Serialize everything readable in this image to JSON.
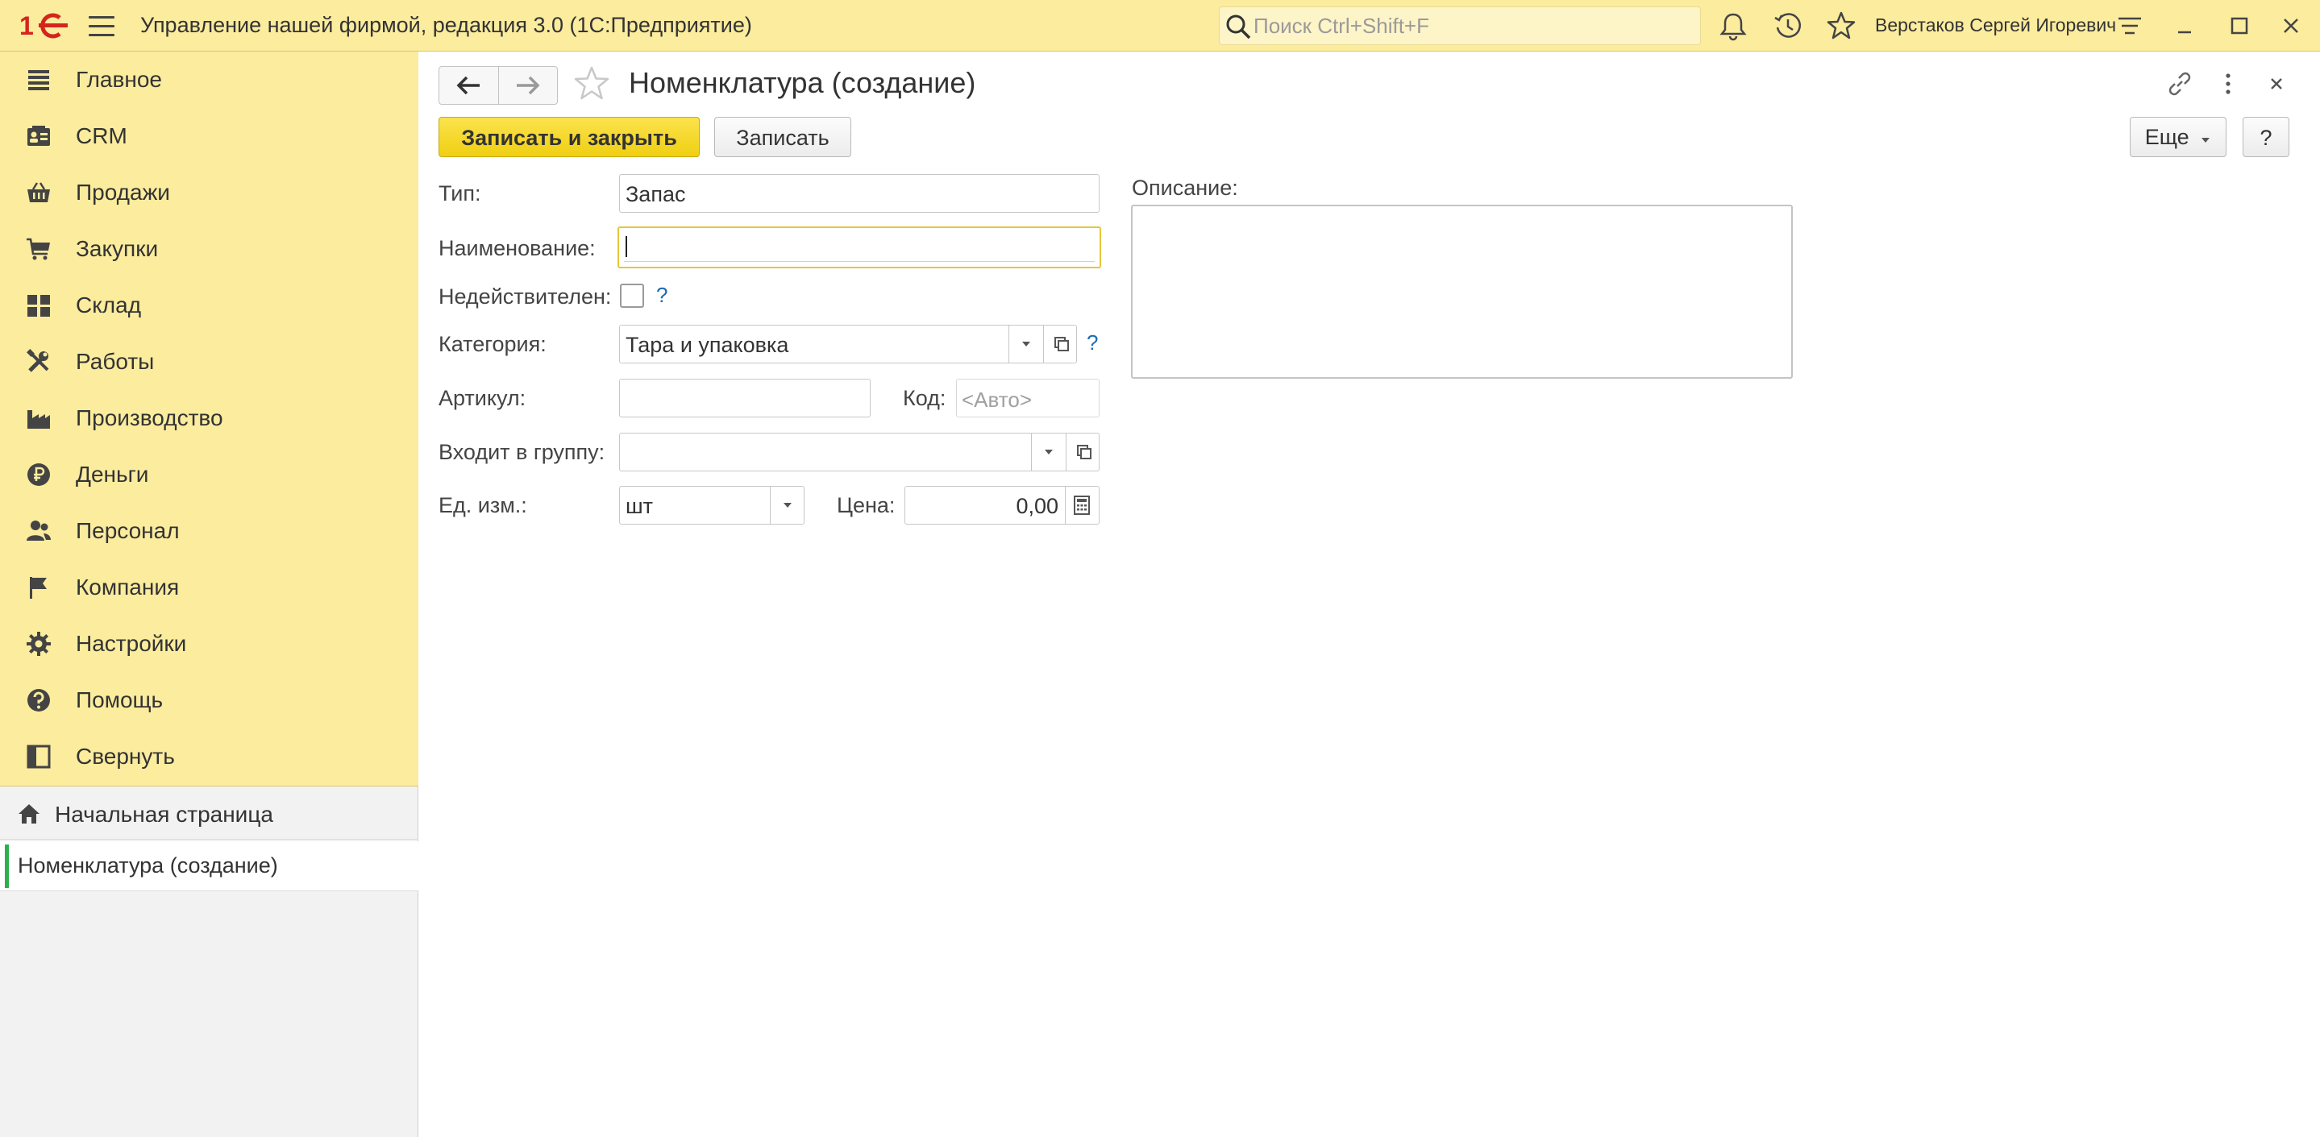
{
  "titlebar": {
    "app_title": "Управление нашей фирмой, редакция 3.0  (1С:Предприятие)",
    "search_placeholder": "Поиск Ctrl+Shift+F",
    "user_name": "Верстаков Сергей Игоревич"
  },
  "sidebar": {
    "sections": [
      {
        "label": "Главное",
        "icon": "menu-lines-icon"
      },
      {
        "label": "CRM",
        "icon": "contact-card-icon"
      },
      {
        "label": "Продажи",
        "icon": "basket-icon"
      },
      {
        "label": "Закупки",
        "icon": "cart-icon"
      },
      {
        "label": "Склад",
        "icon": "warehouse-grid-icon"
      },
      {
        "label": "Работы",
        "icon": "tools-icon"
      },
      {
        "label": "Производство",
        "icon": "factory-icon"
      },
      {
        "label": "Деньги",
        "icon": "ruble-coin-icon"
      },
      {
        "label": "Персонал",
        "icon": "people-icon"
      },
      {
        "label": "Компания",
        "icon": "flag-icon"
      },
      {
        "label": "Настройки",
        "icon": "gear-icon"
      },
      {
        "label": "Помощь",
        "icon": "question-circle-icon"
      },
      {
        "label": "Свернуть",
        "icon": "collapse-panel-icon"
      }
    ],
    "home_label": "Начальная страница",
    "open_window_label": "Номенклатура (создание)"
  },
  "form": {
    "title": "Номенклатура (создание)",
    "save_close_label": "Записать и закрыть",
    "save_label": "Записать",
    "more_label": "Еще",
    "help_label": "?",
    "fields": {
      "type_label": "Тип:",
      "type_value": "Запас",
      "name_label": "Наименование:",
      "name_value": "",
      "invalid_label": "Недействителен:",
      "category_label": "Категория:",
      "category_value": "Тара и упаковка",
      "article_label": "Артикул:",
      "article_value": "",
      "code_label": "Код:",
      "code_placeholder": "<Авто>",
      "group_label": "Входит в группу:",
      "group_value": "",
      "unit_label": "Ед. изм.:",
      "unit_value": "шт",
      "price_label": "Цена:",
      "price_value": "0,00",
      "description_label": "Описание:",
      "help_mark": "?"
    }
  },
  "colors": {
    "panel_yellow": "#fbec9e",
    "primary_button": "#f7d81c",
    "active_marker": "#2db04a",
    "help_blue": "#1a6bb8"
  }
}
